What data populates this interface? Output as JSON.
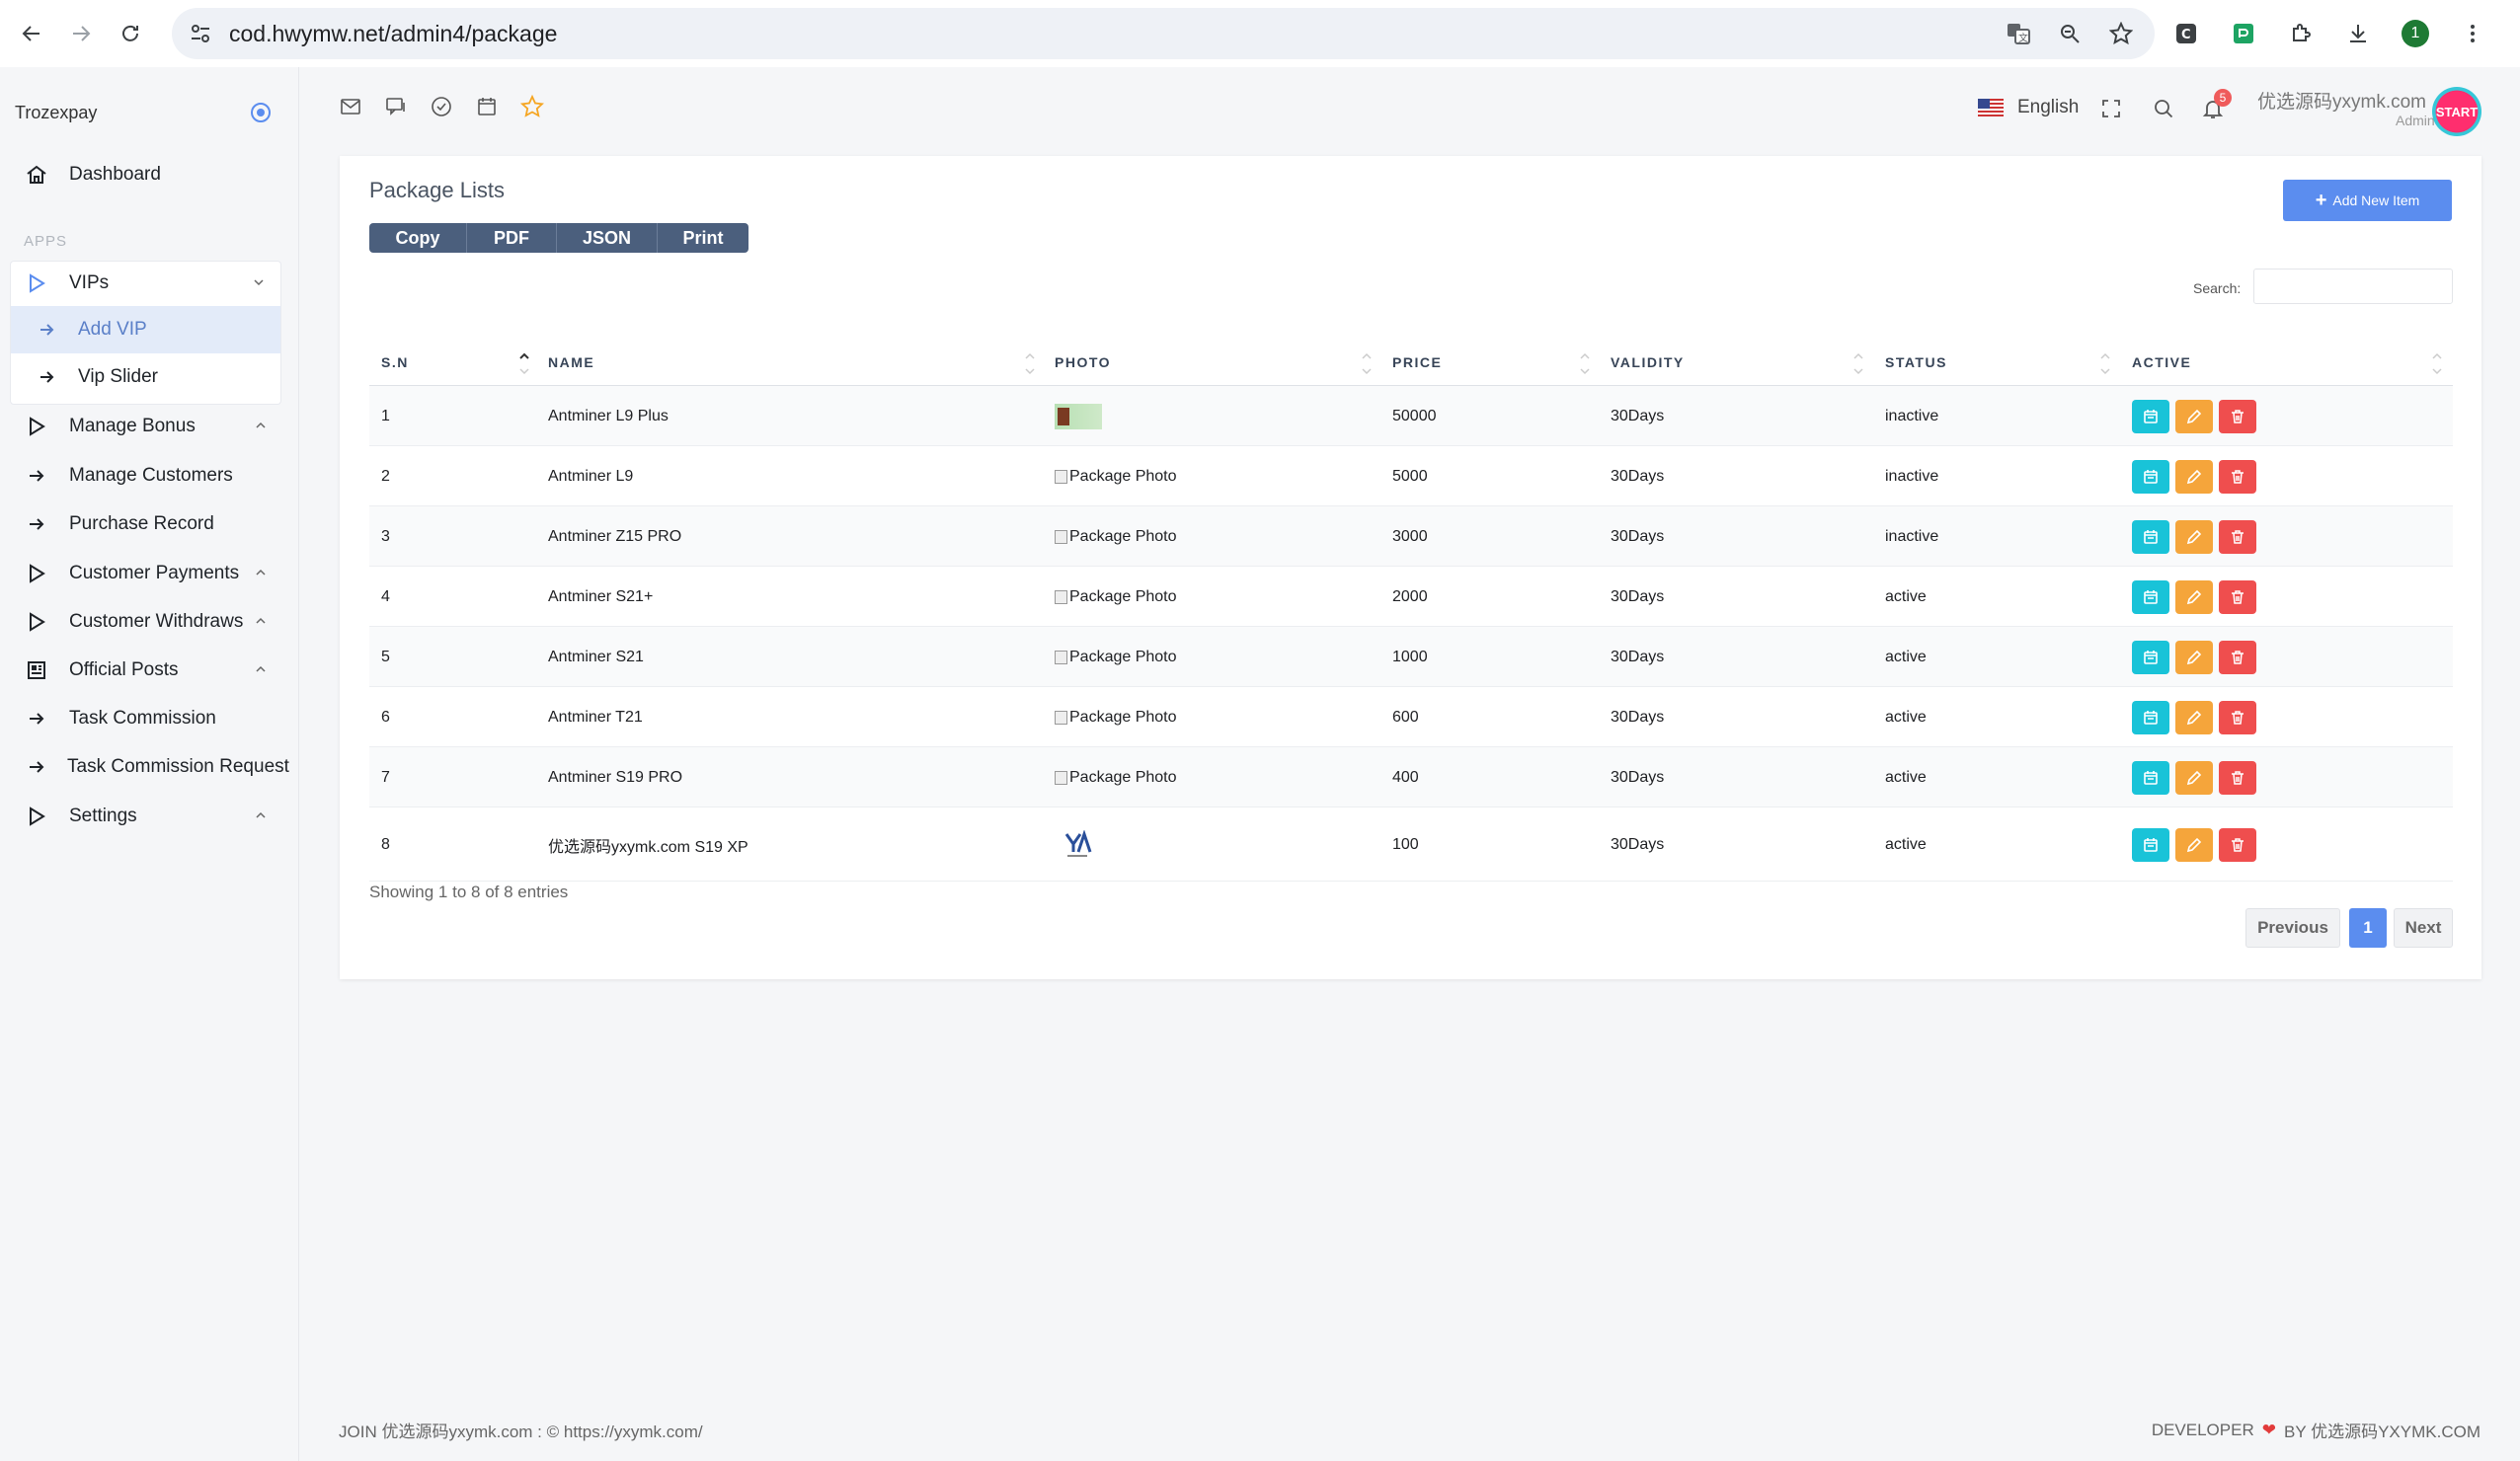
{
  "browser": {
    "url": "cod.hwymw.net/admin4/package",
    "profile_initial": "1"
  },
  "sidebar": {
    "brand": "Trozexpay",
    "dashboard": "Dashboard",
    "apps_label": "APPS",
    "vips": "VIPs",
    "add_vip": "Add VIP",
    "vip_slider": "Vip Slider",
    "manage_bonus": "Manage Bonus",
    "manage_customers": "Manage Customers",
    "purchase_record": "Purchase Record",
    "customer_payments": "Customer Payments",
    "customer_withdraws": "Customer Withdraws",
    "official_posts": "Official Posts",
    "task_commission": "Task Commission",
    "task_commission_request": "Task Commission Request",
    "settings": "Settings"
  },
  "header": {
    "language": "English",
    "notification_count": "5",
    "user_name": "优选源码yxymk.com",
    "user_role": "Admin",
    "avatar_text": "START"
  },
  "card": {
    "title": "Package Lists",
    "export_buttons": [
      "Copy",
      "PDF",
      "JSON",
      "Print"
    ],
    "add_button": "Add New Item",
    "search_label": "Search:",
    "columns": [
      "S.N",
      "NAME",
      "PHOTO",
      "PRICE",
      "VALIDITY",
      "STATUS",
      "ACTIVE"
    ],
    "photo_alt": "Package Photo",
    "rows": [
      {
        "sn": "1",
        "name": "Antminer L9 Plus",
        "photo": "thumb",
        "price": "50000",
        "validity": "30Days",
        "status": "inactive"
      },
      {
        "sn": "2",
        "name": "Antminer L9",
        "photo": "broken",
        "price": "5000",
        "validity": "30Days",
        "status": "inactive"
      },
      {
        "sn": "3",
        "name": "Antminer Z15 PRO",
        "photo": "broken",
        "price": "3000",
        "validity": "30Days",
        "status": "inactive"
      },
      {
        "sn": "4",
        "name": "Antminer S21+",
        "photo": "broken",
        "price": "2000",
        "validity": "30Days",
        "status": "active"
      },
      {
        "sn": "5",
        "name": "Antminer S21",
        "photo": "broken",
        "price": "1000",
        "validity": "30Days",
        "status": "active"
      },
      {
        "sn": "6",
        "name": "Antminer T21",
        "photo": "broken",
        "price": "600",
        "validity": "30Days",
        "status": "active"
      },
      {
        "sn": "7",
        "name": "Antminer S19 PRO",
        "photo": "broken",
        "price": "400",
        "validity": "30Days",
        "status": "active"
      },
      {
        "sn": "8",
        "name": "优选源码yxymk.com S19 XP",
        "photo": "logo",
        "price": "100",
        "validity": "30Days",
        "status": "active"
      }
    ],
    "showing": "Showing 1 to 8 of 8 entries",
    "pager": {
      "prev": "Previous",
      "current": "1",
      "next": "Next"
    }
  },
  "footer": {
    "left": "JOIN 优选源码yxymk.com : © https://yxymk.com/",
    "right_prefix": "DEVELOPER",
    "right_suffix": "BY 优选源码YXYMK.COM"
  },
  "colors": {
    "primary": "#5b8def",
    "view": "#19c3d8",
    "edit": "#f5a53b",
    "delete": "#ef4e4e",
    "export": "#4b5f7d"
  }
}
